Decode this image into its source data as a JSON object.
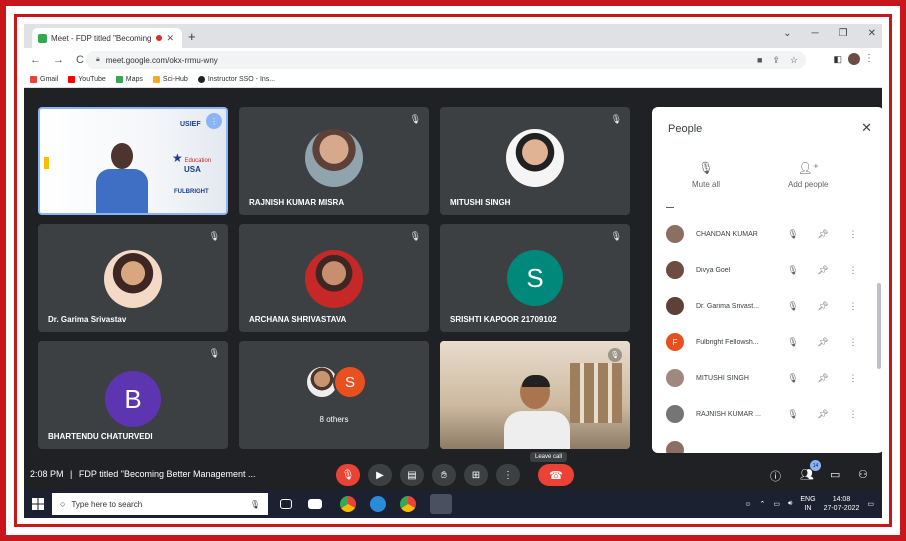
{
  "browser": {
    "tab_title": "Meet - FDP titled \"Becoming",
    "tab_close": "✕",
    "new_tab": "+",
    "url": "meet.google.com/okx-rrmu-wny",
    "bookmarks": [
      "Gmail",
      "YouTube",
      "Maps",
      "Sci-Hub",
      "Instructor SSO - Ins..."
    ]
  },
  "tiles": [
    {
      "name": "RAJNISH KUMAR MISRA"
    },
    {
      "name": "MITUSHI SINGH"
    },
    {
      "name": "Dr. Garima Srivastav"
    },
    {
      "name": "ARCHANA SHRIVASTAVA"
    },
    {
      "name": "SRISHTI KAPOOR 21709102",
      "letter": "S"
    },
    {
      "name": "BHARTENDU CHATURVEDI",
      "letter": "B"
    },
    {
      "name": "8 others",
      "letter": "S"
    }
  ],
  "presenter": {
    "logo_text_1": "USIEF",
    "logo_text_2": "Education",
    "logo_text_3": "USA",
    "logo_text_4": "FULBRIGHT"
  },
  "bottom": {
    "time": "2:08 PM",
    "divider": "|",
    "meeting_title": "FDP titled \"Becoming Better Management ...",
    "leave_tooltip": "Leave call",
    "people_badge": "14"
  },
  "panel": {
    "title": "People",
    "mute_all": "Mute all",
    "add_people": "Add people",
    "participants": [
      {
        "name": "CHANDAN KUMAR",
        "color": "#8d6e63"
      },
      {
        "name": "Divya Goel",
        "color": "#6d4c41"
      },
      {
        "name": "Dr. Garima Srivast...",
        "color": "#5d4037"
      },
      {
        "name": "Fulbright Fellowsh...",
        "color": "#e8501f",
        "letter": "F"
      },
      {
        "name": "MITUSHI SINGH",
        "color": "#a1887f"
      },
      {
        "name": "RAJNISH KUMAR ...",
        "color": "#757575"
      }
    ]
  },
  "taskbar": {
    "search_placeholder": "Type here to search",
    "lang_1": "ENG",
    "lang_2": "IN",
    "clock_time": "14:08",
    "clock_date": "27-07-2022"
  },
  "colors": {
    "frame": "#c8161d",
    "meet_bg": "#202124",
    "tile": "#3c4043",
    "s_avatar": "#00897b",
    "b_avatar": "#5e35b1",
    "s_small": "#e8501f"
  }
}
